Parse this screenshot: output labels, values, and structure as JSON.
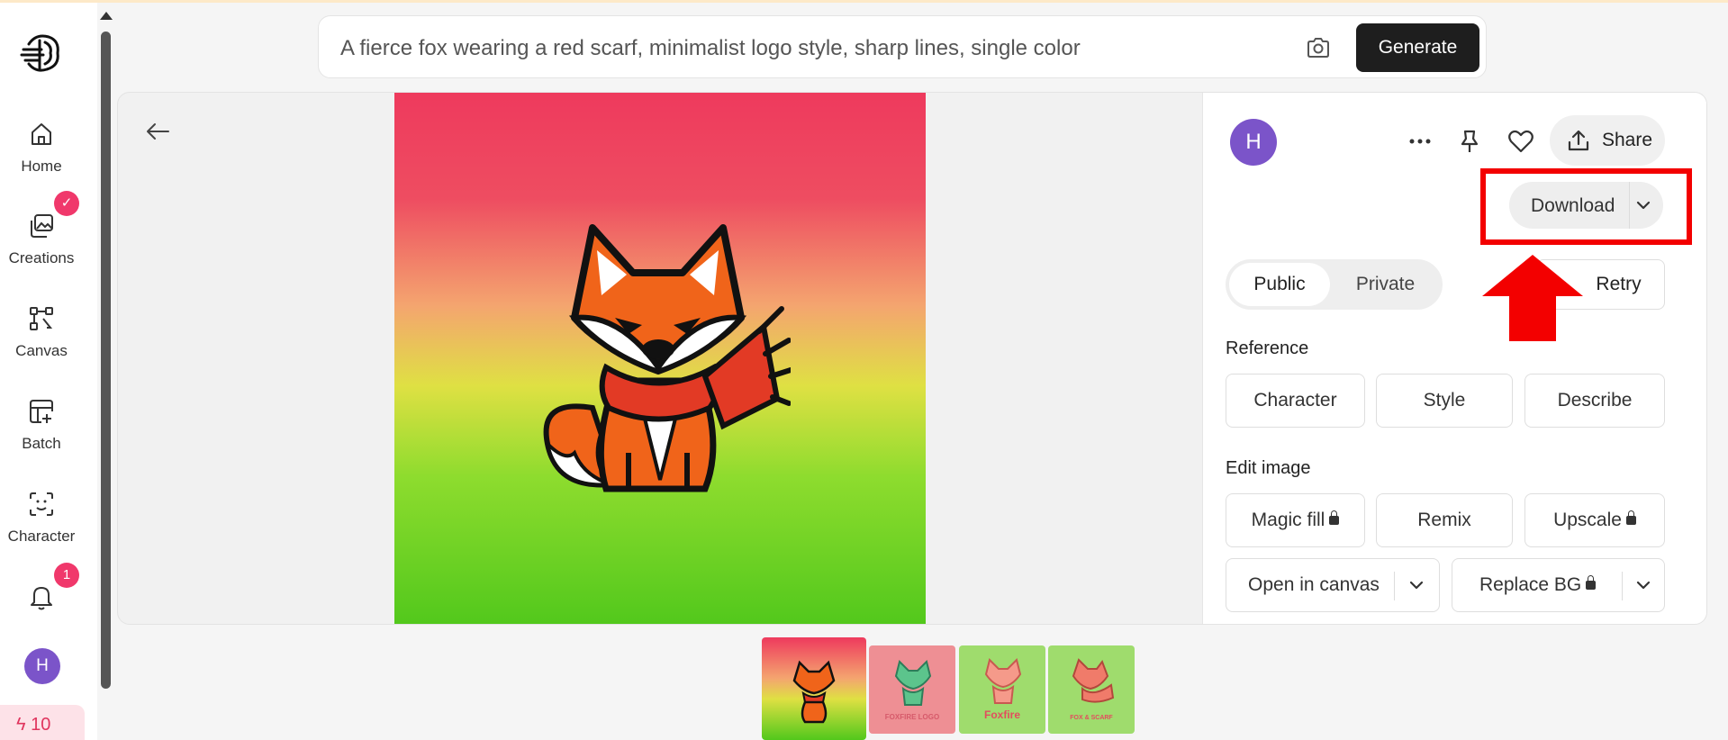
{
  "sidebar": {
    "items": [
      {
        "label": "Home",
        "icon": "home-icon"
      },
      {
        "label": "Creations",
        "icon": "images-icon",
        "badge": "✓"
      },
      {
        "label": "Canvas",
        "icon": "canvas-icon"
      },
      {
        "label": "Batch",
        "icon": "batch-icon"
      },
      {
        "label": "Character",
        "icon": "face-scan-icon"
      }
    ],
    "notifications_badge": "1",
    "avatar_initial": "H",
    "credits": "10"
  },
  "prompt": {
    "text": "A fierce fox wearing a red scarf, minimalist logo style, sharp lines, single color",
    "generate_label": "Generate"
  },
  "detail": {
    "avatar_initial": "H",
    "share_label": "Share",
    "download_label": "Download",
    "visibility": {
      "public": "Public",
      "private": "Private",
      "selected": "Public"
    },
    "retry_label": "Retry",
    "reference_title": "Reference",
    "reference_buttons": [
      "Character",
      "Style",
      "Describe"
    ],
    "edit_title": "Edit image",
    "edit_buttons": [
      "Magic fill",
      "Remix",
      "Upscale"
    ],
    "open_canvas_label": "Open in canvas",
    "replace_bg_label": "Replace BG"
  },
  "thumbnails": [
    {
      "caption": ""
    },
    {
      "caption": "FOXFIRE LOGO"
    },
    {
      "caption": "Foxfire"
    },
    {
      "caption": "FOX & SCARF"
    }
  ],
  "colors": {
    "accent_red": "#f30000",
    "badge_pink": "#f0386b",
    "avatar_purple": "#7b54c9",
    "generate_bg": "#1e1e1e"
  }
}
